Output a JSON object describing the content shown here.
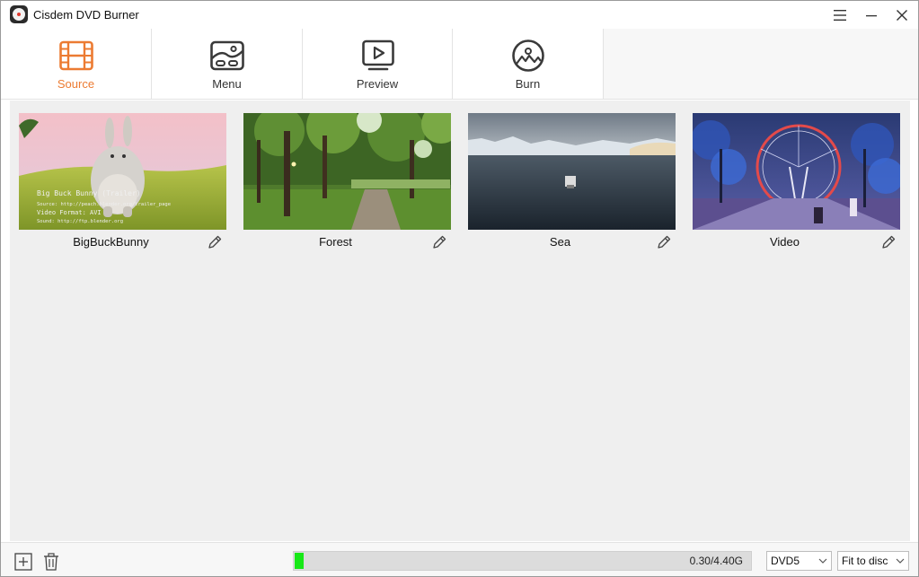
{
  "window": {
    "title": "Cisdem DVD Burner"
  },
  "toolbar": {
    "tabs": [
      {
        "label": "Source",
        "icon": "film-icon",
        "active": true
      },
      {
        "label": "Menu",
        "icon": "menu-template-icon",
        "active": false
      },
      {
        "label": "Preview",
        "icon": "play-screen-icon",
        "active": false
      },
      {
        "label": "Burn",
        "icon": "disc-burn-icon",
        "active": false
      }
    ]
  },
  "videos": [
    {
      "title": "BigBuckBunny",
      "thumb_text": [
        "Big Buck Bunny (Trailer)",
        "Source: http://peach.blender.org/trailer_page",
        "Video Format: AVI",
        "Sound: http://ftp.blender.org"
      ]
    },
    {
      "title": "Forest"
    },
    {
      "title": "Sea"
    },
    {
      "title": "Video"
    }
  ],
  "footer": {
    "usage_text": "0.30/4.40G",
    "usage_fraction": 0.068,
    "disc_type": "DVD5",
    "fit_mode": "Fit to disc"
  },
  "colors": {
    "accent": "#ec7b32",
    "progress": "#17e817",
    "content_bg": "#efefef"
  }
}
